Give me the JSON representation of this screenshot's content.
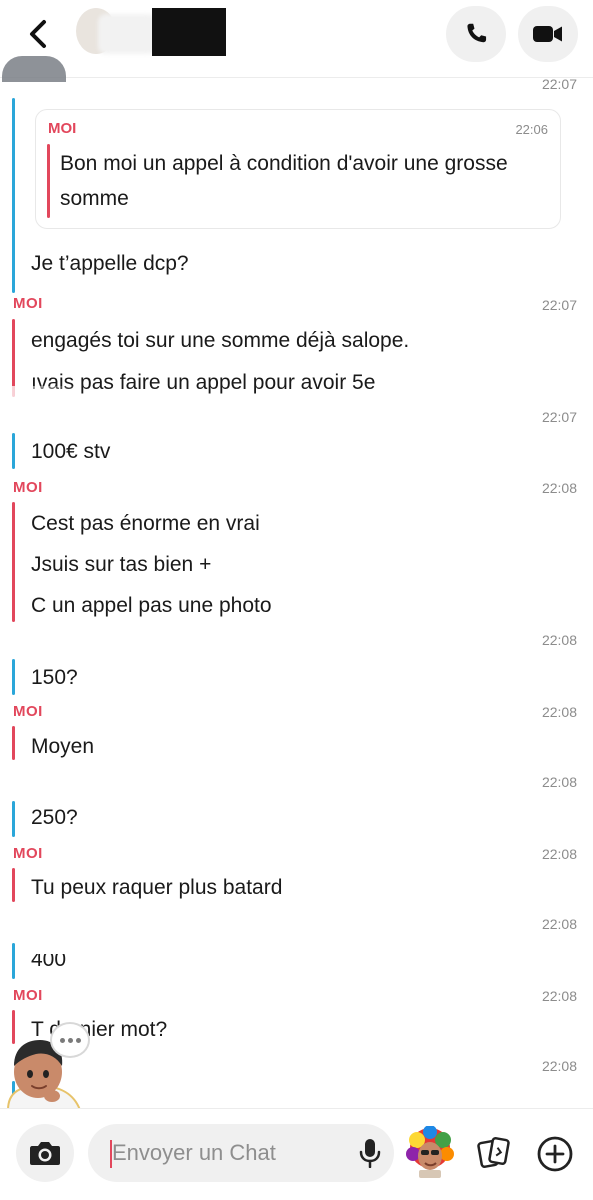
{
  "header": {
    "back_icon": "chevron-left-icon",
    "call_icon": "phone-icon",
    "video_icon": "video-camera-icon"
  },
  "colors": {
    "me": "#e2475c",
    "friend": "#2aa6d9",
    "timestamp": "#8c8c8c"
  },
  "messages": {
    "m1_time": "22:07",
    "quote": {
      "sender": "MOI",
      "time": "22:06",
      "text": "Bon moi un appel à condition d'avoir une grosse somme"
    },
    "m1_text": "Je t’appelle dcp?",
    "m2_sender": "MOI",
    "m2_time": "22:07",
    "m2_line1": "engagés toi sur une somme déjà salope.",
    "m2_line2": "ıvais pas faire un appel pour avoir 5e",
    "m3_time": "22:07",
    "m3_text": "100€ stv",
    "m4_sender": "MOI",
    "m4_time": "22:08",
    "m4_line1": "Cest pas énorme en vrai",
    "m4_line2": "Jsuis sur tas bien +",
    "m4_line3": "C un appel pas une photo",
    "m5_time": "22:08",
    "m5_text": "150?",
    "m6_sender": "MOI",
    "m6_time": "22:08",
    "m6_text": "Moyen",
    "m7_time": "22:08",
    "m7_text": "250?",
    "m8_sender": "MOI",
    "m8_time": "22:08",
    "m8_text": "Tu peux raquer plus batard",
    "m9_time": "22:08",
    "m9_text": "400",
    "m10_sender": "MOI",
    "m10_time": "22:08",
    "m10_text": "T  dernier mot?",
    "m11_time": "22:08"
  },
  "composer": {
    "placeholder": "Envoyer un Chat",
    "camera_icon": "camera-icon",
    "mic_icon": "microphone-icon",
    "sticker_icon": "bitmoji-sticker-icon",
    "cards_icon": "cards-icon",
    "plus_icon": "plus-circle-icon"
  }
}
